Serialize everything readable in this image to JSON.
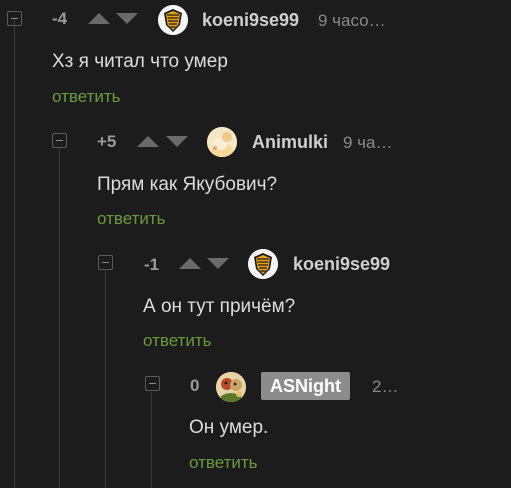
{
  "comments": [
    {
      "rating": "-4",
      "username": "koeni9se99",
      "time": "9 часо…",
      "text": "Хз я читал что умер",
      "reply_label": "ответить",
      "avatar_icon": "koenigsegg-shield-icon"
    },
    {
      "rating": "+5",
      "username": "Animulki",
      "time": "9 ча…",
      "text": "Прям как Якубович?",
      "reply_label": "ответить",
      "avatar_icon": "anime-avatar-icon"
    },
    {
      "rating": "-1",
      "username": "koeni9se99",
      "time": "",
      "text": "А он тут причём?",
      "reply_label": "ответить",
      "avatar_icon": "koenigsegg-shield-icon"
    },
    {
      "rating": "0",
      "username": "ASNight",
      "time": "2…",
      "text": "Он умер.",
      "reply_label": "ответить",
      "avatar_icon": "cartoon-avatar-icon"
    }
  ],
  "colors": {
    "background": "#1c1c1c",
    "reply_link": "#6b9a3e",
    "author_badge": "#8c8c8c"
  }
}
